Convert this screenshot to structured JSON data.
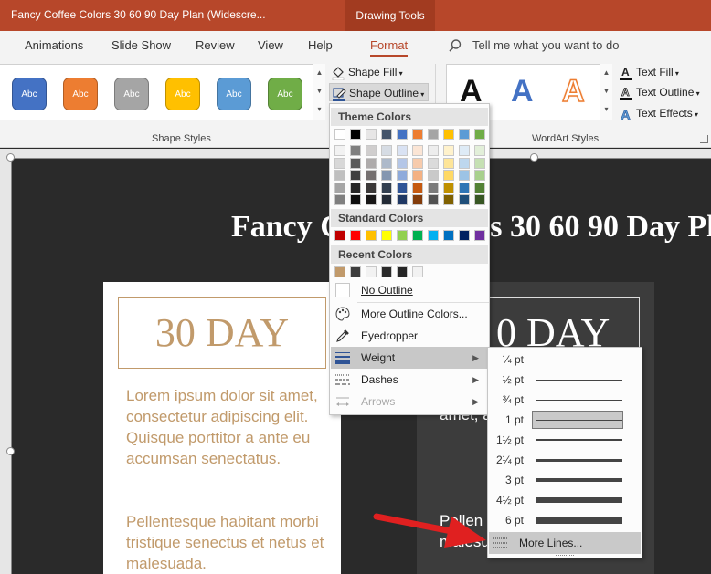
{
  "titlebar": {
    "doc_title": "Fancy Coffee Colors 30 60 90 Day Plan (Widescre...",
    "context_tab": "Drawing Tools"
  },
  "tabs": [
    "Animations",
    "Slide Show",
    "Review",
    "View",
    "Help",
    "Format"
  ],
  "active_tab": "Format",
  "tell_me": "Tell me what you want to do",
  "ribbon": {
    "style_label": "Abc",
    "style_colors": [
      "#4472c4",
      "#ed7d31",
      "#a5a5a5",
      "#ffc000",
      "#5b9bd5",
      "#70ad47"
    ],
    "shape_fill": "Shape Fill",
    "shape_outline": "Shape Outline",
    "shape_styles_caption": "Shape Styles",
    "wordart_letter": "A",
    "text_fill": "Text Fill",
    "text_outline": "Text Outline",
    "text_effects": "Text Effects",
    "wordart_caption": "WordArt Styles"
  },
  "slide": {
    "title": "Fancy Coffee Colors 30 60 90 Day Plan",
    "left_card": {
      "day": "30 DAY",
      "para1": "Lorem ipsum dolor sit amet, consectetur adipiscing elit. Quisque porttitor a ante eu accumsan senectatus.",
      "para2": "Pellentesque habitant morbi tristique senectus et netus et malesuada."
    },
    "right_card": {
      "day": "0 DAY",
      "para1": "amet, adipisc portti accum",
      "para2": "Pellen morbi et netus et malesuada."
    }
  },
  "outline_menu": {
    "theme_colors_header": "Theme Colors",
    "theme_top_row": [
      "#ffffff",
      "#000000",
      "#e7e6e6",
      "#44546a",
      "#4472c4",
      "#ed7d31",
      "#a5a5a5",
      "#ffc000",
      "#5b9bd5",
      "#70ad47"
    ],
    "theme_shades": [
      [
        "#f2f2f2",
        "#7f7f7f",
        "#d0cece",
        "#d6dce4",
        "#d9e2f3",
        "#fbe5d5",
        "#ededed",
        "#fff2cc",
        "#deebf6",
        "#e2efd9"
      ],
      [
        "#d8d8d8",
        "#595959",
        "#aeabab",
        "#adb9ca",
        "#b4c6e7",
        "#f7cbac",
        "#dbdbdb",
        "#fee599",
        "#bdd7ee",
        "#c5e0b3"
      ],
      [
        "#bfbfbf",
        "#3f3f3f",
        "#757070",
        "#8496b0",
        "#8eaadb",
        "#f4b183",
        "#c9c9c9",
        "#ffd965",
        "#9cc3e5",
        "#a8d08d"
      ],
      [
        "#a5a5a5",
        "#262626",
        "#3a3838",
        "#323f4f",
        "#2f5496",
        "#c55a11",
        "#7b7b7b",
        "#bf9000",
        "#2e75b5",
        "#538135"
      ],
      [
        "#7f7f7f",
        "#0c0c0c",
        "#171616",
        "#222a35",
        "#1f3864",
        "#833c0b",
        "#525252",
        "#7f6000",
        "#1e4e79",
        "#375623"
      ]
    ],
    "standard_colors_header": "Standard Colors",
    "standard_colors": [
      "#c00000",
      "#ff0000",
      "#ffc000",
      "#ffff00",
      "#92d050",
      "#00b050",
      "#00b0f0",
      "#0070c0",
      "#002060",
      "#7030a0"
    ],
    "recent_colors_header": "Recent Colors",
    "recent_colors": [
      "#c19a6b",
      "#3c3c3c",
      "#f2f2f2",
      "#2a2a2a",
      "#262626",
      "#f2f2f2"
    ],
    "no_outline": "No Outline",
    "more_outline_colors": "More Outline Colors...",
    "eyedropper": "Eyedropper",
    "weight": "Weight",
    "dashes": "Dashes",
    "arrows": "Arrows"
  },
  "weight_menu": {
    "options": [
      {
        "label": "¼ pt",
        "thickness": 0.25
      },
      {
        "label": "½ pt",
        "thickness": 0.5
      },
      {
        "label": "¾ pt",
        "thickness": 0.75
      },
      {
        "label": "1 pt",
        "thickness": 1,
        "selected": true
      },
      {
        "label": "1½ pt",
        "thickness": 1.5
      },
      {
        "label": "2¼ pt",
        "thickness": 2.25
      },
      {
        "label": "3 pt",
        "thickness": 3
      },
      {
        "label": "4½ pt",
        "thickness": 4.5
      },
      {
        "label": "6 pt",
        "thickness": 6
      }
    ],
    "more_lines": "More Lines..."
  },
  "icons": {
    "search": "search-icon",
    "shape_fill": "paint-bucket-icon",
    "shape_outline": "pen-outline-icon",
    "text_fill": "text-fill-icon",
    "text_outline": "text-outline-icon",
    "text_effects": "text-effects-icon",
    "more_colors": "palette-icon",
    "eyedropper": "eyedropper-icon",
    "weight": "line-weight-icon",
    "dashes": "dashes-icon",
    "arrows": "arrows-icon",
    "more_lines": "more-lines-icon"
  },
  "annotation_color": "#e02020"
}
